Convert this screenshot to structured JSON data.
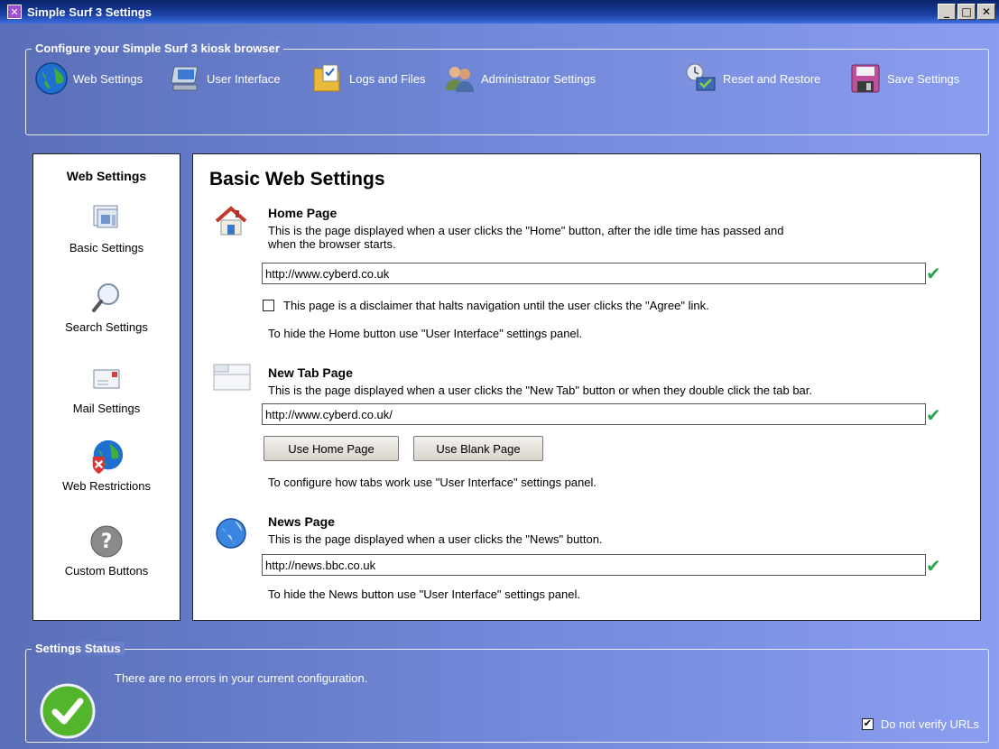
{
  "window": {
    "title": "Simple Surf 3 Settings",
    "min_glyph": "_",
    "max_glyph": "□",
    "close_glyph": "✕"
  },
  "toolbar": {
    "group_label": "Configure your Simple Surf 3 kiosk browser",
    "items": [
      {
        "label": "Web Settings",
        "icon": "globe-icon"
      },
      {
        "label": "User Interface",
        "icon": "computer-icon"
      },
      {
        "label": "Logs and Files",
        "icon": "folder-icon"
      },
      {
        "label": "Administrator Settings",
        "icon": "users-icon"
      },
      {
        "label": "Reset and Restore",
        "icon": "restore-icon"
      },
      {
        "label": "Save Settings",
        "icon": "floppy-icon"
      }
    ]
  },
  "sidebar": {
    "title": "Web Settings",
    "items": [
      {
        "label": "Basic Settings",
        "icon": "windows-icon"
      },
      {
        "label": "Search Settings",
        "icon": "magnifier-icon"
      },
      {
        "label": "Mail Settings",
        "icon": "envelope-icon"
      },
      {
        "label": "Web Restrictions",
        "icon": "restricted-globe-icon"
      },
      {
        "label": "Custom Buttons",
        "icon": "question-icon"
      }
    ]
  },
  "main": {
    "title": "Basic Web Settings",
    "home": {
      "title": "Home Page",
      "desc1": "This is the page displayed when a user clicks the \"Home\" button, after the idle time has passed and",
      "desc2": "when the browser starts.",
      "url": "http://www.cyberd.co.uk",
      "disclaimer_label": "This page is a disclaimer that halts navigation until the user clicks the \"Agree\" link.",
      "disclaimer_checked": false,
      "hint": "To hide the Home button use \"User Interface\" settings panel."
    },
    "newtab": {
      "title": "New Tab Page",
      "desc": "This is the page displayed when a user clicks the \"New Tab\" button or when they double click the tab bar.",
      "url": "http://www.cyberd.co.uk/",
      "use_home_label": "Use Home Page",
      "use_blank_label": "Use Blank Page",
      "hint": "To configure how tabs work use \"User Interface\" settings panel."
    },
    "news": {
      "title": "News Page",
      "desc": "This is the page displayed when a user clicks the \"News\" button.",
      "url": "http://news.bbc.co.uk",
      "hint": "To hide the News button use \"User Interface\" settings panel."
    },
    "valid_glyph": "✔"
  },
  "status": {
    "group_label": "Settings Status",
    "message": "There are no errors in your current configuration.",
    "no_verify_label": "Do not verify URLs",
    "no_verify_checked": true,
    "check_glyph": "✔"
  },
  "colors": {
    "valid_green": "#2ea44f",
    "title_bar": "#0a246a"
  }
}
